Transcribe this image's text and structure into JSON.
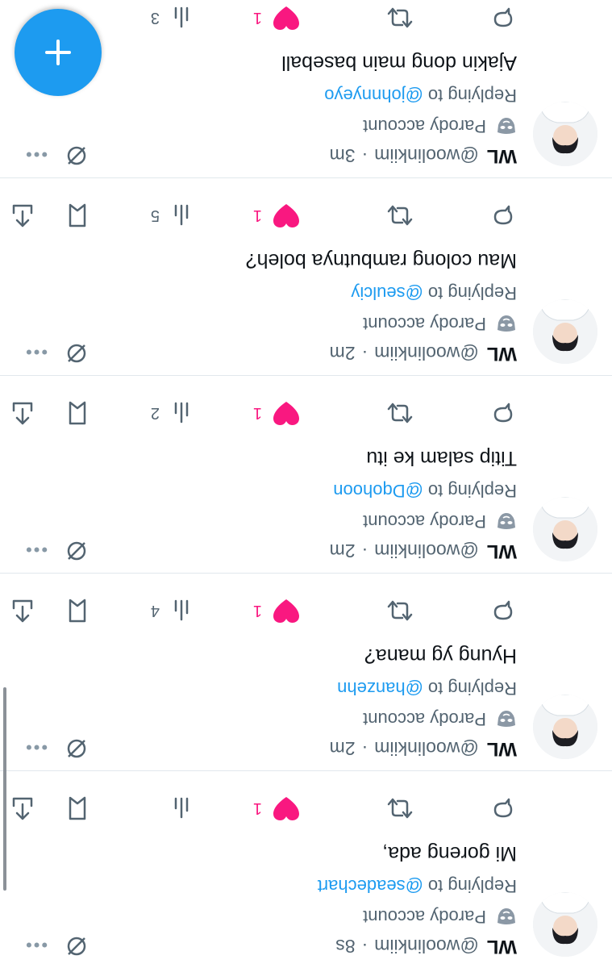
{
  "tweets": [
    {
      "name": "WL",
      "handle": "@woolinkiim",
      "separator": "·",
      "time": "8s",
      "parody_label": "Parody account",
      "replying_prefix": "Replying to",
      "replying_to": "@seadechart",
      "text": "Mi goreng ada,",
      "likes": "1",
      "views": ""
    },
    {
      "name": "WL",
      "handle": "@woolinkiim",
      "separator": "·",
      "time": "2m",
      "parody_label": "Parody account",
      "replying_prefix": "Replying to",
      "replying_to": "@hanzehn",
      "text": "Hyung yg mana?",
      "likes": "1",
      "views": "4"
    },
    {
      "name": "WL",
      "handle": "@woolinkiim",
      "separator": "·",
      "time": "2m",
      "parody_label": "Parody account",
      "replying_prefix": "Replying to",
      "replying_to": "@Dqohoon",
      "text": "Titip salam ke itu",
      "likes": "1",
      "views": "2"
    },
    {
      "name": "WL",
      "handle": "@woolinkiim",
      "separator": "·",
      "time": "2m",
      "parody_label": "Parody account",
      "replying_prefix": "Replying to",
      "replying_to": "@seulciy",
      "text": "Mau colong rambutnya boleh?",
      "likes": "1",
      "views": "5"
    },
    {
      "name": "WL",
      "handle": "@woolinkiim",
      "separator": "·",
      "time": "3m",
      "parody_label": "Parody account",
      "replying_prefix": "Replying to",
      "replying_to": "@johnnyeyo",
      "text": "Ajakin dong main baseball",
      "likes": "1",
      "views": "3"
    }
  ],
  "icons": {
    "reply": "reply-icon",
    "retweet": "retweet-icon",
    "like": "heart-icon",
    "views": "views-icon",
    "bookmark": "bookmark-icon",
    "share": "share-icon",
    "more": "more-icon",
    "not_interested": "not-interested-icon",
    "compose": "plus-icon"
  },
  "colors": {
    "accent": "#1d9bf0",
    "like": "#f91880",
    "muted": "#536471"
  }
}
